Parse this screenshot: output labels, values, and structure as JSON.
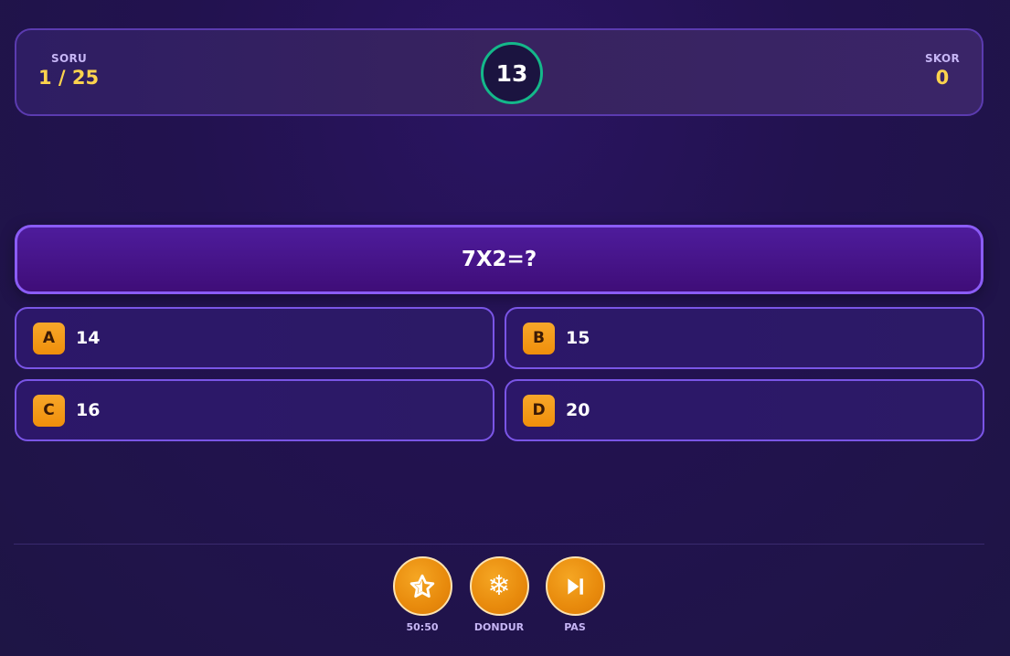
{
  "header": {
    "question_label": "SORU",
    "question_progress": "1 / 25",
    "timer": "13",
    "score_label": "SKOR",
    "score_value": "0"
  },
  "question": {
    "text": "7X2=?"
  },
  "options": [
    {
      "letter": "A",
      "text": "14"
    },
    {
      "letter": "B",
      "text": "15"
    },
    {
      "letter": "C",
      "text": "16"
    },
    {
      "letter": "D",
      "text": "20"
    }
  ],
  "powerups": [
    {
      "label": "50:50",
      "icon": "star-icon"
    },
    {
      "label": "DONDUR",
      "icon": "snowflake-icon"
    },
    {
      "label": "PAS",
      "icon": "skip-icon"
    }
  ],
  "colors": {
    "accent_gold": "#fcd34d",
    "option_badge": "#f59e0b",
    "timer_ring": "#14b88a",
    "border_purple": "#8b5cf6"
  }
}
